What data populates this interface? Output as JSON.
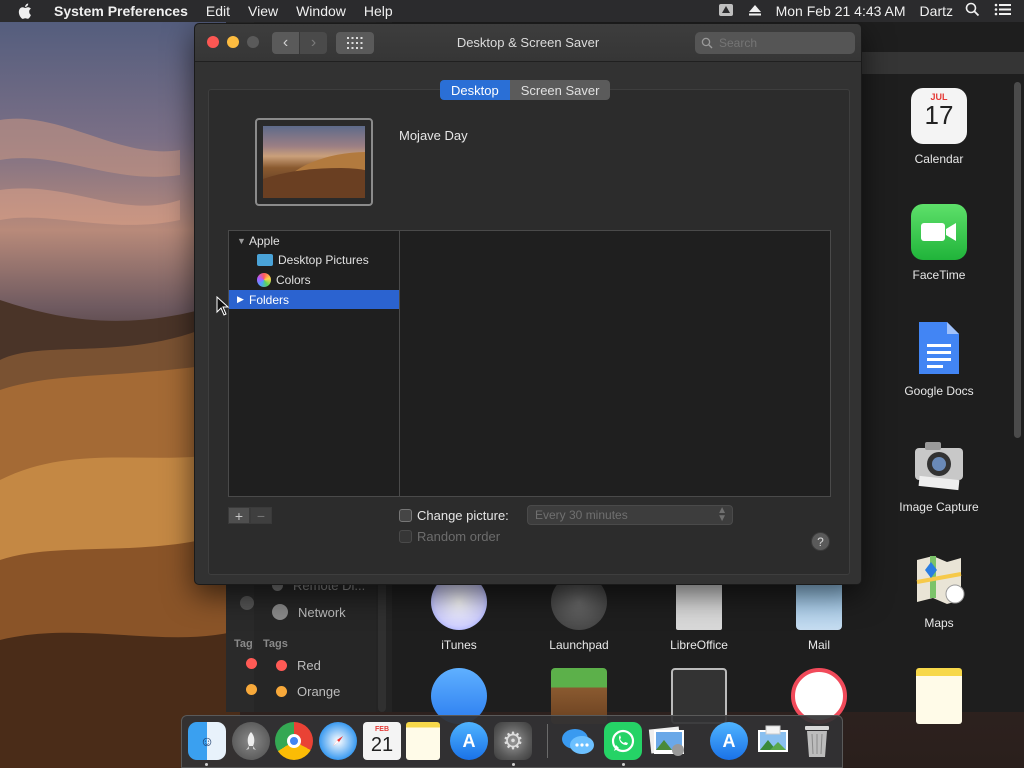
{
  "menubar": {
    "app_name": "System Preferences",
    "menus": [
      "Edit",
      "View",
      "Window",
      "Help"
    ],
    "clock": "Mon Feb 21  4:43 AM",
    "user": "Dartz"
  },
  "window": {
    "title": "Desktop & Screen Saver",
    "search_placeholder": "Search",
    "tabs": [
      {
        "label": "Desktop",
        "active": true
      },
      {
        "label": "Screen Saver",
        "active": false
      }
    ],
    "current_picture_name": "Mojave Day",
    "sources": [
      {
        "label": "Apple",
        "expanded": true
      },
      {
        "label": "Desktop Pictures"
      },
      {
        "label": "Colors"
      },
      {
        "label": "Folders",
        "selected": true
      }
    ],
    "add_label": "+",
    "remove_label": "−",
    "change_picture_label": "Change picture:",
    "change_picture_checked": false,
    "interval_value": "Every 30 minutes",
    "random_order_label": "Random order",
    "help_label": "?"
  },
  "finder": {
    "sidebar": {
      "partial_item": "Remote Di...",
      "network": "Network",
      "tags_header": "Tags",
      "tags_header_short": "Tag",
      "tags": [
        {
          "label": "Red",
          "color": "#ff5a55"
        },
        {
          "label": "Orange",
          "color": "#f8a93a"
        }
      ]
    },
    "apps": [
      {
        "label": "Calendar",
        "month": "JUL",
        "day": "17"
      },
      {
        "label": "FaceTime"
      },
      {
        "label": "Google Docs"
      },
      {
        "label": "Image Capture"
      },
      {
        "label": "iTunes"
      },
      {
        "label": "Launchpad"
      },
      {
        "label": "LibreOffice"
      },
      {
        "label": "Mail"
      },
      {
        "label": "Maps"
      }
    ]
  },
  "dock": {
    "items": [
      "Finder",
      "Launchpad",
      "Chrome",
      "Safari",
      "Calendar",
      "Notes",
      "App Store",
      "System Preferences",
      "Messages",
      "WhatsApp",
      "Preview",
      "App Store",
      "Image Viewer",
      "Trash"
    ],
    "calendar_month": "FEB",
    "calendar_day": "21"
  },
  "colors": {
    "accent": "#2a6fd6",
    "selection": "#2b63d0",
    "close": "#fc5753",
    "minimize": "#fdbc40",
    "zoom": "#5a5a5a"
  }
}
